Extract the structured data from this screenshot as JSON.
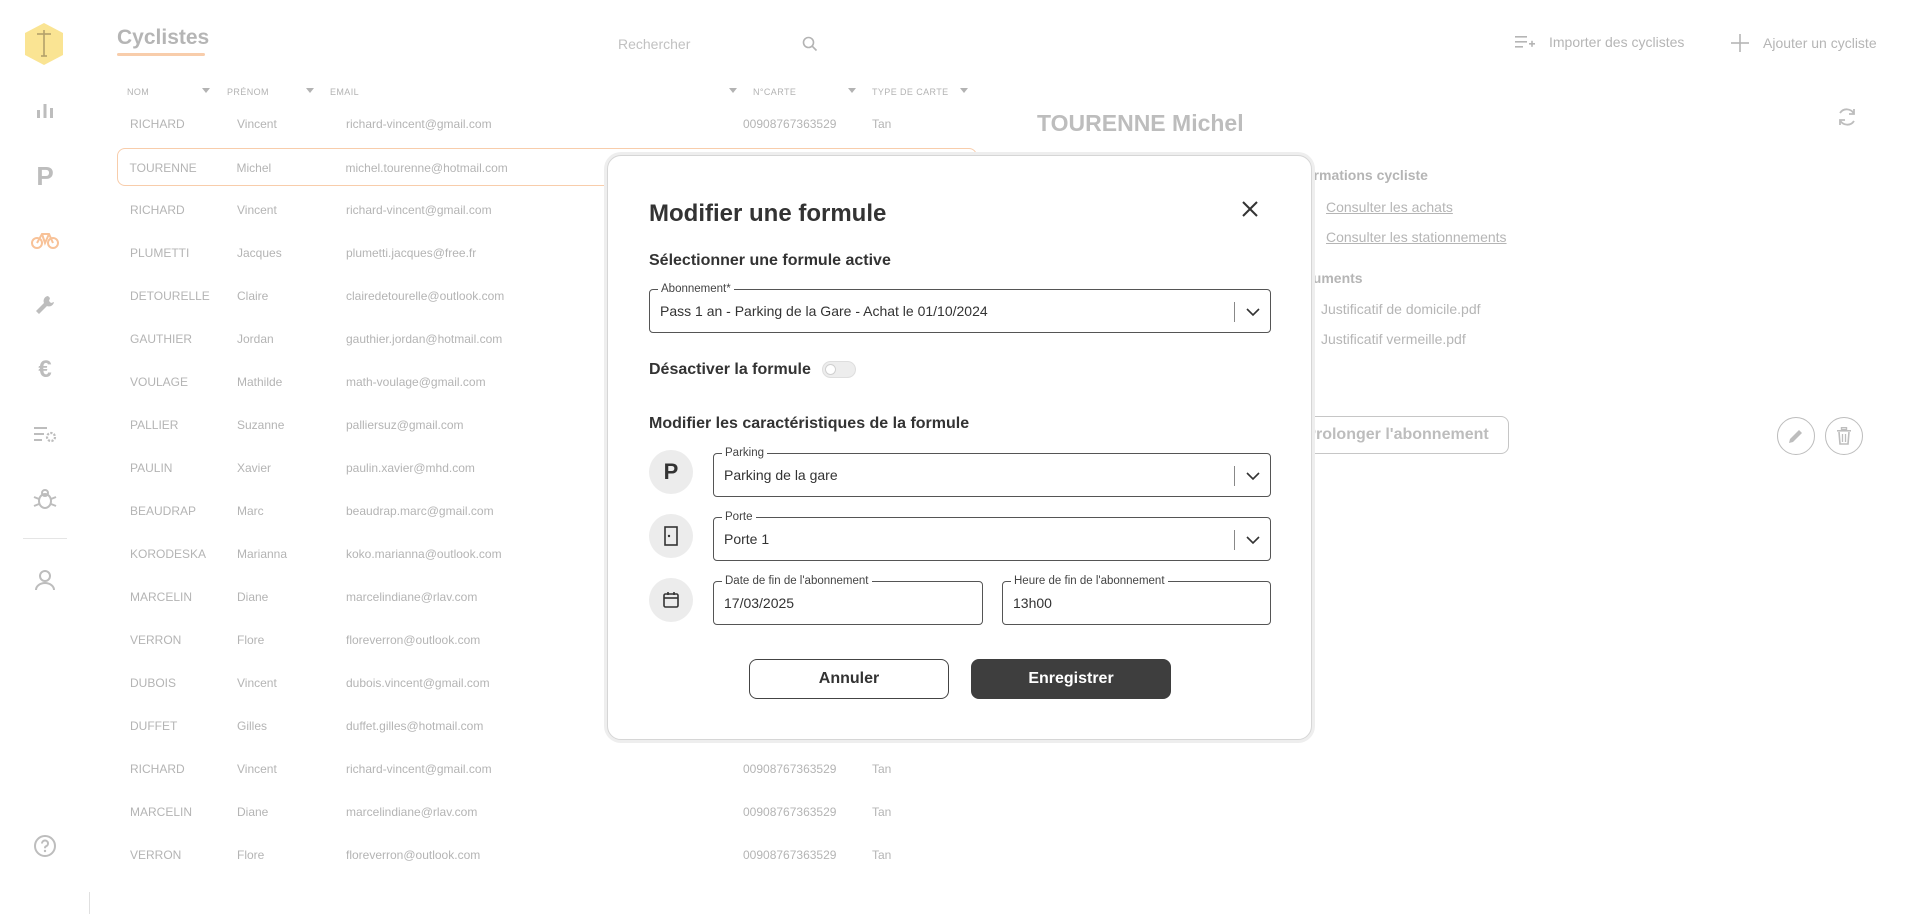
{
  "header": {
    "title": "Cyclistes",
    "search_placeholder": "Rechercher",
    "import_label": "Importer des cyclistes",
    "add_label": "Ajouter un cycliste"
  },
  "sidebar": {
    "items": [
      {
        "icon": "chart-icon"
      },
      {
        "icon": "parking-icon",
        "glyph": "P"
      },
      {
        "icon": "bicycle-icon",
        "active": true
      },
      {
        "icon": "wrench-icon"
      },
      {
        "icon": "euro-icon",
        "glyph": "€"
      },
      {
        "icon": "settings-list-icon"
      },
      {
        "icon": "bug-icon"
      },
      {
        "icon": "user-icon"
      }
    ],
    "help_icon": "help-icon"
  },
  "table": {
    "columns": [
      "NOM",
      "PRÉNOM",
      "EMAIL",
      "N°CARTE",
      "TYPE DE CARTE"
    ],
    "rows": [
      [
        "RICHARD",
        "Vincent",
        "richard-vincent@gmail.com",
        "00908767363529",
        "Tan"
      ],
      [
        "TOURENNE",
        "Michel",
        "michel.tourenne@hotmail.com",
        "",
        ""
      ],
      [
        "RICHARD",
        "Vincent",
        "richard-vincent@gmail.com",
        "",
        ""
      ],
      [
        "PLUMETTI",
        "Jacques",
        "plumetti.jacques@free.fr",
        "",
        ""
      ],
      [
        "DETOURELLE",
        "Claire",
        "clairedetourelle@outlook.com",
        "",
        ""
      ],
      [
        "GAUTHIER",
        "Jordan",
        "gauthier.jordan@hotmail.com",
        "",
        ""
      ],
      [
        "VOULAGE",
        "Mathilde",
        "math-voulage@gmail.com",
        "",
        ""
      ],
      [
        "PALLIER",
        "Suzanne",
        "palliersuz@gmail.com",
        "",
        ""
      ],
      [
        "PAULIN",
        "Xavier",
        "paulin.xavier@mhd.com",
        "",
        ""
      ],
      [
        "BEAUDRAP",
        "Marc",
        "beaudrap.marc@gmail.com",
        "",
        ""
      ],
      [
        "KORODESKA",
        "Marianna",
        "koko.marianna@outlook.com",
        "",
        ""
      ],
      [
        "MARCELIN",
        "Diane",
        "marcelindiane@rlav.com",
        "",
        ""
      ],
      [
        "VERRON",
        "Flore",
        "floreverron@outlook.com",
        "",
        ""
      ],
      [
        "DUBOIS",
        "Vincent",
        "dubois.vincent@gmail.com",
        "",
        ""
      ],
      [
        "DUFFET",
        "Gilles",
        "duffet.gilles@hotmail.com",
        "",
        ""
      ],
      [
        "RICHARD",
        "Vincent",
        "richard-vincent@gmail.com",
        "00908767363529",
        "Tan"
      ],
      [
        "MARCELIN",
        "Diane",
        "marcelindiane@rlav.com",
        "00908767363529",
        "Tan"
      ],
      [
        "VERRON",
        "Flore",
        "floreverron@outlook.com",
        "00908767363529",
        "Tan"
      ]
    ],
    "selected_index": 1
  },
  "detail": {
    "name": "TOURENNE Michel",
    "info_title": "ormations cycliste",
    "link_purchases": "Consulter les achats",
    "link_parkings": "Consulter les stationnements",
    "docs_title": "cuments",
    "doc1": "Justificatif de domicile.pdf",
    "doc2": "Justificatif vermeille.pdf",
    "prolong_label": "Prolonger l'abonnement"
  },
  "modal": {
    "title": "Modifier une formule",
    "section_active": "Sélectionner une formule active",
    "subscription_label": "Abonnement*",
    "subscription_value": "Pass 1 an - Parking de la Gare - Achat le 01/10/2024",
    "deactivate_label": "Désactiver la formule",
    "deactivate_on": false,
    "section_edit": "Modifier les caractéristiques de la formule",
    "parking_label": "Parking",
    "parking_value": "Parking de la gare",
    "door_label": "Porte",
    "door_value": "Porte 1",
    "end_date_label": "Date de fin de l'abonnement",
    "end_date_value": "17/03/2025",
    "end_time_label": "Heure de fin de l'abonnement",
    "end_time_value": "13h00",
    "cancel_label": "Annuler",
    "save_label": "Enregistrer"
  },
  "colors": {
    "accent": "#f4b27f",
    "primary_button": "#3e3e3e",
    "logo": "#f7d65a"
  }
}
